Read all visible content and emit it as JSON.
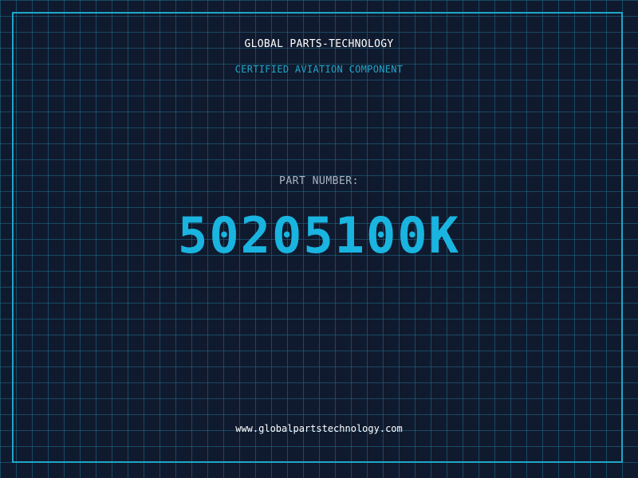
{
  "header": {
    "company": "GLOBAL PARTS-TECHNOLOGY",
    "subtitle": "CERTIFIED AVIATION COMPONENT"
  },
  "part": {
    "label": "PART NUMBER:",
    "number": "50205100K"
  },
  "footer": {
    "website": "www.globalpartstechnology.com"
  },
  "colors": {
    "background": "#101a2e",
    "grid": "#1e6e8c",
    "accent": "#1fa6c8",
    "part_number": "#1ab4e0",
    "label": "#a9b5c6",
    "text": "#ffffff"
  }
}
